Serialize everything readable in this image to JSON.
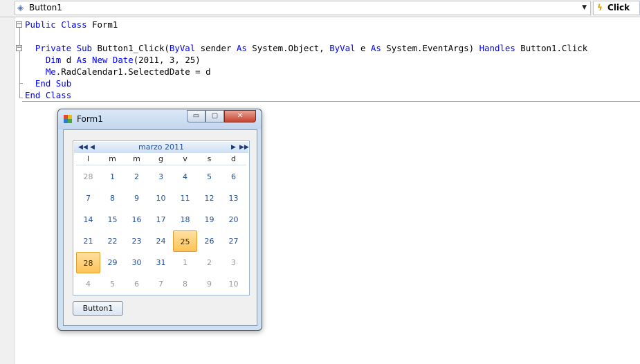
{
  "editor": {
    "class_combo": {
      "value": "Button1",
      "icon": "class-icon"
    },
    "event_combo": {
      "value": "Click",
      "icon": "lightning-icon"
    },
    "code_lines": [
      {
        "tokens": [
          {
            "t": "Public",
            "k": 1
          },
          {
            "t": " "
          },
          {
            "t": "Class",
            "k": 1
          },
          {
            "t": " Form1"
          }
        ]
      },
      {
        "tokens": [
          {
            "t": " "
          }
        ]
      },
      {
        "tokens": [
          {
            "t": "  "
          },
          {
            "t": "Private",
            "k": 1
          },
          {
            "t": " "
          },
          {
            "t": "Sub",
            "k": 1
          },
          {
            "t": " Button1_Click("
          },
          {
            "t": "ByVal",
            "k": 1
          },
          {
            "t": " sender "
          },
          {
            "t": "As",
            "k": 1
          },
          {
            "t": " System.Object, "
          },
          {
            "t": "ByVal",
            "k": 1
          },
          {
            "t": " e "
          },
          {
            "t": "As",
            "k": 1
          },
          {
            "t": " System.EventArgs) "
          },
          {
            "t": "Handles",
            "k": 1
          },
          {
            "t": " Button1.Click"
          }
        ]
      },
      {
        "tokens": [
          {
            "t": "    "
          },
          {
            "t": "Dim",
            "k": 1
          },
          {
            "t": " d "
          },
          {
            "t": "As",
            "k": 1
          },
          {
            "t": " "
          },
          {
            "t": "New",
            "k": 1
          },
          {
            "t": " "
          },
          {
            "t": "Date",
            "k": 1
          },
          {
            "t": "(2011, 3, 25)"
          }
        ]
      },
      {
        "tokens": [
          {
            "t": "    "
          },
          {
            "t": "Me",
            "k": 1
          },
          {
            "t": ".RadCalendar1.SelectedDate = d"
          }
        ]
      },
      {
        "tokens": [
          {
            "t": "  "
          },
          {
            "t": "End",
            "k": 1
          },
          {
            "t": " "
          },
          {
            "t": "Sub",
            "k": 1
          }
        ]
      },
      {
        "tokens": [
          {
            "t": "End",
            "k": 1
          },
          {
            "t": " "
          },
          {
            "t": "Class",
            "k": 1
          }
        ]
      }
    ]
  },
  "form": {
    "title": "Form1",
    "minimize_glyph": "▭",
    "maximize_glyph": "▢",
    "close_glyph": "✕",
    "calendar": {
      "month_label": "marzo 2011",
      "nav": {
        "fast_prev": "◀◀",
        "prev": "◀",
        "next": "▶",
        "fast_next": "▶▶"
      },
      "weekdays": [
        "l",
        "m",
        "m",
        "g",
        "v",
        "s",
        "d"
      ],
      "weeks": [
        [
          {
            "d": "28",
            "o": 1
          },
          {
            "d": "1"
          },
          {
            "d": "2"
          },
          {
            "d": "3"
          },
          {
            "d": "4"
          },
          {
            "d": "5"
          },
          {
            "d": "6"
          }
        ],
        [
          {
            "d": "7"
          },
          {
            "d": "8"
          },
          {
            "d": "9"
          },
          {
            "d": "10"
          },
          {
            "d": "11"
          },
          {
            "d": "12"
          },
          {
            "d": "13"
          }
        ],
        [
          {
            "d": "14"
          },
          {
            "d": "15"
          },
          {
            "d": "16"
          },
          {
            "d": "17"
          },
          {
            "d": "18"
          },
          {
            "d": "19"
          },
          {
            "d": "20"
          }
        ],
        [
          {
            "d": "21"
          },
          {
            "d": "22"
          },
          {
            "d": "23"
          },
          {
            "d": "24"
          },
          {
            "d": "25",
            "s": 1
          },
          {
            "d": "26"
          },
          {
            "d": "27"
          }
        ],
        [
          {
            "d": "28",
            "s": 1
          },
          {
            "d": "29"
          },
          {
            "d": "30"
          },
          {
            "d": "31"
          },
          {
            "d": "1",
            "o": 1
          },
          {
            "d": "2",
            "o": 1
          },
          {
            "d": "3",
            "o": 1
          }
        ],
        [
          {
            "d": "4",
            "o": 1
          },
          {
            "d": "5",
            "o": 1
          },
          {
            "d": "6",
            "o": 1
          },
          {
            "d": "7",
            "o": 1
          },
          {
            "d": "8",
            "o": 1
          },
          {
            "d": "9",
            "o": 1
          },
          {
            "d": "10",
            "o": 1
          }
        ]
      ]
    },
    "button_label": "Button1"
  },
  "colors": {
    "keyword": "#0000ff",
    "calendar_text": "#1e4f9a",
    "selected_day": "#ffc458"
  }
}
